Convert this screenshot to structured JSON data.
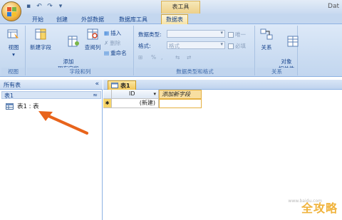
{
  "window": {
    "title_fragment": "Dat",
    "context_tab": "表工具"
  },
  "qat": [
    "▾",
    "↶",
    "↷",
    "▾"
  ],
  "tabs": [
    {
      "label": "开始",
      "active": false
    },
    {
      "label": "创建",
      "active": false
    },
    {
      "label": "外部数据",
      "active": false
    },
    {
      "label": "数据库工具",
      "active": false
    },
    {
      "label": "数据表",
      "active": true
    }
  ],
  "ribbon": {
    "groups": {
      "views": {
        "label": "视图",
        "view_button": "视图",
        "view_arrow": "▾"
      },
      "fields": {
        "label": "字段和列",
        "new_field": "新建字段",
        "add_existing": "添加\n现有字段",
        "lookup_col": "查阅列",
        "insert": "插入",
        "delete": "删除",
        "rename": "重命名"
      },
      "datatype": {
        "label": "数据类型和格式",
        "datatype_label": "数据类型:",
        "format_label": "格式:",
        "format_value": "格式",
        "unique": "唯一",
        "required": "必填",
        "percent": "%",
        "comma": ","
      },
      "relationships": {
        "label": "关系",
        "relations": "关系",
        "object_deps": "对象\n相关性"
      }
    }
  },
  "nav": {
    "header": "所有表",
    "chevron": "«",
    "group": "表1",
    "group_icon": "≈",
    "item": "表1 : 表"
  },
  "doc": {
    "tab": "表1",
    "columns": [
      "ID",
      "添加新字段"
    ],
    "id_sort_arrow": "▾",
    "new_row_marker": "✱",
    "new_row_value": "(新建)"
  },
  "watermark": {
    "text": "全攻略",
    "url": "www.baidu.com"
  },
  "colors": {
    "accent_tab": "#f6e3a8",
    "arrow": "#e8641c",
    "ribbon": "#c9dbf1"
  }
}
